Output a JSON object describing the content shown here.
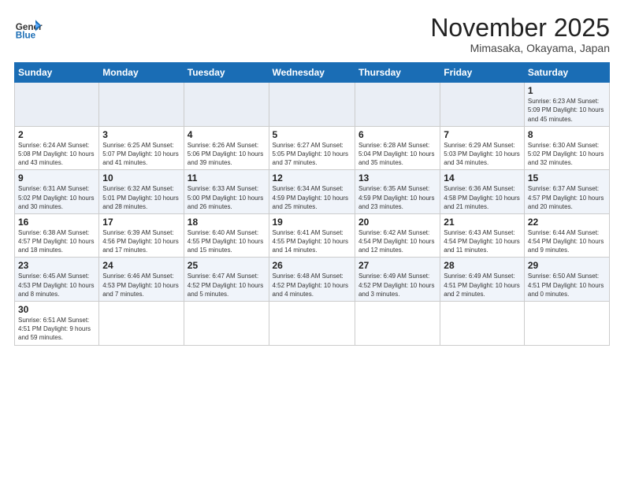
{
  "logo": {
    "text_general": "General",
    "text_blue": "Blue"
  },
  "header": {
    "month": "November 2025",
    "location": "Mimasaka, Okayama, Japan"
  },
  "weekdays": [
    "Sunday",
    "Monday",
    "Tuesday",
    "Wednesday",
    "Thursday",
    "Friday",
    "Saturday"
  ],
  "weeks": [
    [
      {
        "day": "",
        "info": ""
      },
      {
        "day": "",
        "info": ""
      },
      {
        "day": "",
        "info": ""
      },
      {
        "day": "",
        "info": ""
      },
      {
        "day": "",
        "info": ""
      },
      {
        "day": "",
        "info": ""
      },
      {
        "day": "1",
        "info": "Sunrise: 6:23 AM\nSunset: 5:09 PM\nDaylight: 10 hours and 45 minutes."
      }
    ],
    [
      {
        "day": "2",
        "info": "Sunrise: 6:24 AM\nSunset: 5:08 PM\nDaylight: 10 hours and 43 minutes."
      },
      {
        "day": "3",
        "info": "Sunrise: 6:25 AM\nSunset: 5:07 PM\nDaylight: 10 hours and 41 minutes."
      },
      {
        "day": "4",
        "info": "Sunrise: 6:26 AM\nSunset: 5:06 PM\nDaylight: 10 hours and 39 minutes."
      },
      {
        "day": "5",
        "info": "Sunrise: 6:27 AM\nSunset: 5:05 PM\nDaylight: 10 hours and 37 minutes."
      },
      {
        "day": "6",
        "info": "Sunrise: 6:28 AM\nSunset: 5:04 PM\nDaylight: 10 hours and 35 minutes."
      },
      {
        "day": "7",
        "info": "Sunrise: 6:29 AM\nSunset: 5:03 PM\nDaylight: 10 hours and 34 minutes."
      },
      {
        "day": "8",
        "info": "Sunrise: 6:30 AM\nSunset: 5:02 PM\nDaylight: 10 hours and 32 minutes."
      }
    ],
    [
      {
        "day": "9",
        "info": "Sunrise: 6:31 AM\nSunset: 5:02 PM\nDaylight: 10 hours and 30 minutes."
      },
      {
        "day": "10",
        "info": "Sunrise: 6:32 AM\nSunset: 5:01 PM\nDaylight: 10 hours and 28 minutes."
      },
      {
        "day": "11",
        "info": "Sunrise: 6:33 AM\nSunset: 5:00 PM\nDaylight: 10 hours and 26 minutes."
      },
      {
        "day": "12",
        "info": "Sunrise: 6:34 AM\nSunset: 4:59 PM\nDaylight: 10 hours and 25 minutes."
      },
      {
        "day": "13",
        "info": "Sunrise: 6:35 AM\nSunset: 4:59 PM\nDaylight: 10 hours and 23 minutes."
      },
      {
        "day": "14",
        "info": "Sunrise: 6:36 AM\nSunset: 4:58 PM\nDaylight: 10 hours and 21 minutes."
      },
      {
        "day": "15",
        "info": "Sunrise: 6:37 AM\nSunset: 4:57 PM\nDaylight: 10 hours and 20 minutes."
      }
    ],
    [
      {
        "day": "16",
        "info": "Sunrise: 6:38 AM\nSunset: 4:57 PM\nDaylight: 10 hours and 18 minutes."
      },
      {
        "day": "17",
        "info": "Sunrise: 6:39 AM\nSunset: 4:56 PM\nDaylight: 10 hours and 17 minutes."
      },
      {
        "day": "18",
        "info": "Sunrise: 6:40 AM\nSunset: 4:55 PM\nDaylight: 10 hours and 15 minutes."
      },
      {
        "day": "19",
        "info": "Sunrise: 6:41 AM\nSunset: 4:55 PM\nDaylight: 10 hours and 14 minutes."
      },
      {
        "day": "20",
        "info": "Sunrise: 6:42 AM\nSunset: 4:54 PM\nDaylight: 10 hours and 12 minutes."
      },
      {
        "day": "21",
        "info": "Sunrise: 6:43 AM\nSunset: 4:54 PM\nDaylight: 10 hours and 11 minutes."
      },
      {
        "day": "22",
        "info": "Sunrise: 6:44 AM\nSunset: 4:54 PM\nDaylight: 10 hours and 9 minutes."
      }
    ],
    [
      {
        "day": "23",
        "info": "Sunrise: 6:45 AM\nSunset: 4:53 PM\nDaylight: 10 hours and 8 minutes."
      },
      {
        "day": "24",
        "info": "Sunrise: 6:46 AM\nSunset: 4:53 PM\nDaylight: 10 hours and 7 minutes."
      },
      {
        "day": "25",
        "info": "Sunrise: 6:47 AM\nSunset: 4:52 PM\nDaylight: 10 hours and 5 minutes."
      },
      {
        "day": "26",
        "info": "Sunrise: 6:48 AM\nSunset: 4:52 PM\nDaylight: 10 hours and 4 minutes."
      },
      {
        "day": "27",
        "info": "Sunrise: 6:49 AM\nSunset: 4:52 PM\nDaylight: 10 hours and 3 minutes."
      },
      {
        "day": "28",
        "info": "Sunrise: 6:49 AM\nSunset: 4:51 PM\nDaylight: 10 hours and 2 minutes."
      },
      {
        "day": "29",
        "info": "Sunrise: 6:50 AM\nSunset: 4:51 PM\nDaylight: 10 hours and 0 minutes."
      }
    ],
    [
      {
        "day": "30",
        "info": "Sunrise: 6:51 AM\nSunset: 4:51 PM\nDaylight: 9 hours and 59 minutes."
      },
      {
        "day": "",
        "info": ""
      },
      {
        "day": "",
        "info": ""
      },
      {
        "day": "",
        "info": ""
      },
      {
        "day": "",
        "info": ""
      },
      {
        "day": "",
        "info": ""
      },
      {
        "day": "",
        "info": ""
      }
    ]
  ]
}
